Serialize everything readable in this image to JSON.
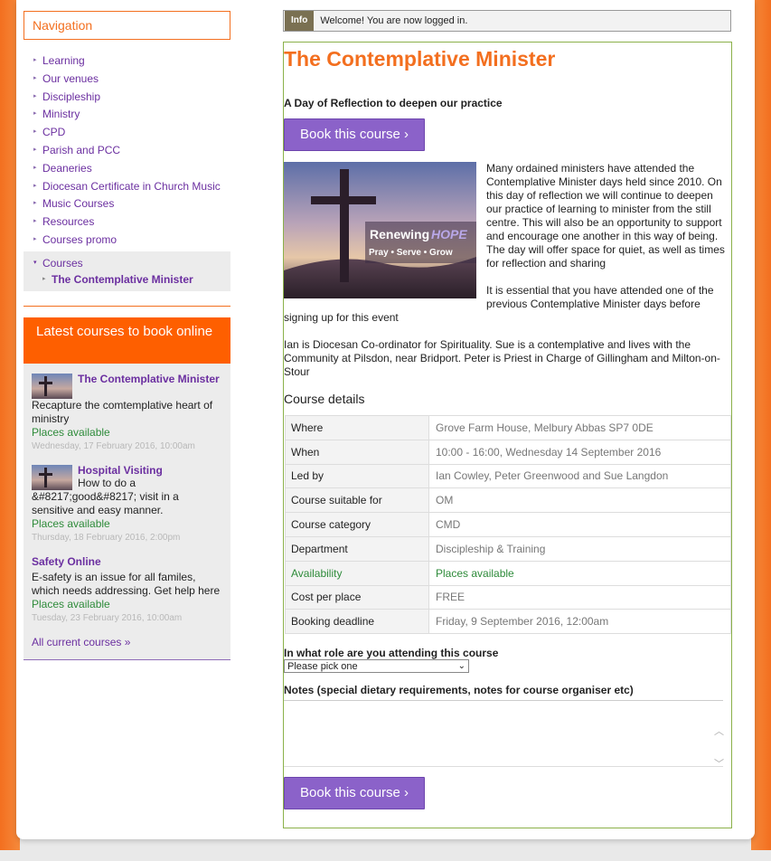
{
  "colors": {
    "accent_orange": "#f36f1f",
    "latest_header": "#fe5f00",
    "purple_link": "#6b2fa0",
    "button_purple": "#8b62c9",
    "available_green": "#2e8b3a",
    "main_border_green": "#8bb14a"
  },
  "sidebar": {
    "nav_title": "Navigation",
    "nav_items": [
      {
        "label": "Learning"
      },
      {
        "label": "Our venues"
      },
      {
        "label": "Discipleship"
      },
      {
        "label": "Ministry"
      },
      {
        "label": "CPD"
      },
      {
        "label": "Parish and PCC"
      },
      {
        "label": "Deaneries"
      },
      {
        "label": "Diocesan Certificate in Church Music"
      },
      {
        "label": "Music Courses"
      },
      {
        "label": "Resources"
      },
      {
        "label": "Courses promo"
      }
    ],
    "current_item": "Courses",
    "current_sub_item": "The Contemplative Minister",
    "latest_title": "Latest courses to book online",
    "latest_courses": [
      {
        "title": "The Contemplative Minister",
        "desc": "Recapture the comtemplative heart of ministry",
        "availability": "Places available",
        "date": "Wednesday, 17 February 2016, 10:00am"
      },
      {
        "title": "Hospital Visiting",
        "desc": "How to do a &#8217;good&#8217; visit in a sensitive and easy manner.",
        "availability": "Places available",
        "date": "Thursday, 18 February 2016, 2:00pm"
      },
      {
        "title": "Safety Online",
        "desc": "E-safety is an issue for all familes, which needs addressing. Get help here",
        "availability": "Places available",
        "date": "Tuesday, 23 February 2016, 10:00am"
      }
    ],
    "all_courses_link": "All current courses »"
  },
  "info": {
    "tag": "Info",
    "message": "Welcome! You are now logged in."
  },
  "course": {
    "title": "The Contemplative Minister",
    "subtitle": "A Day of Reflection to deepen our practice",
    "book_button": "Book this course ›",
    "image_text_1": "Renewing",
    "image_text_2": "HOPE",
    "image_text_3": "Pray • Serve • Grow",
    "intro": "Many ordained ministers have attended the Contemplative Minister days held since 2010. On this day of reflection we will continue to deepen our practice of learning to minister from the still centre. This will also be an opportunity to support and encourage one another in this way of being. The day will offer space for quiet, as well as times for reflection and sharing",
    "prerequisite": "It is essential that you have attended one of the previous Contemplative Minister days before signing up for this event",
    "leaders_bio": "Ian is Diocesan Co-ordinator for Spirituality. Sue is a contemplative and lives with the Community at Pilsdon, near Bridport. Peter is Priest in Charge of Gillingham and Milton-on-Stour",
    "details_heading": "Course details",
    "details": [
      {
        "label": "Where",
        "value": "Grove Farm House, Melbury Abbas SP7 0DE"
      },
      {
        "label": "When",
        "value": "10:00 - 16:00, Wednesday 14 September 2016"
      },
      {
        "label": "Led by",
        "value": "Ian Cowley, Peter Greenwood and Sue Langdon"
      },
      {
        "label": "Course suitable for",
        "value": "OM"
      },
      {
        "label": "Course category",
        "value": "CMD"
      },
      {
        "label": "Department",
        "value": "Discipleship & Training"
      },
      {
        "label": "Availability",
        "value": "Places available"
      },
      {
        "label": "Cost per place",
        "value": "FREE"
      },
      {
        "label": "Booking deadline",
        "value": "Friday, 9 September 2016, 12:00am"
      }
    ],
    "role_question": "In what role are you attending this course",
    "role_selected": "Please pick one",
    "notes_question": "Notes (special dietary requirements, notes for course organiser etc)",
    "notes_value": ""
  }
}
